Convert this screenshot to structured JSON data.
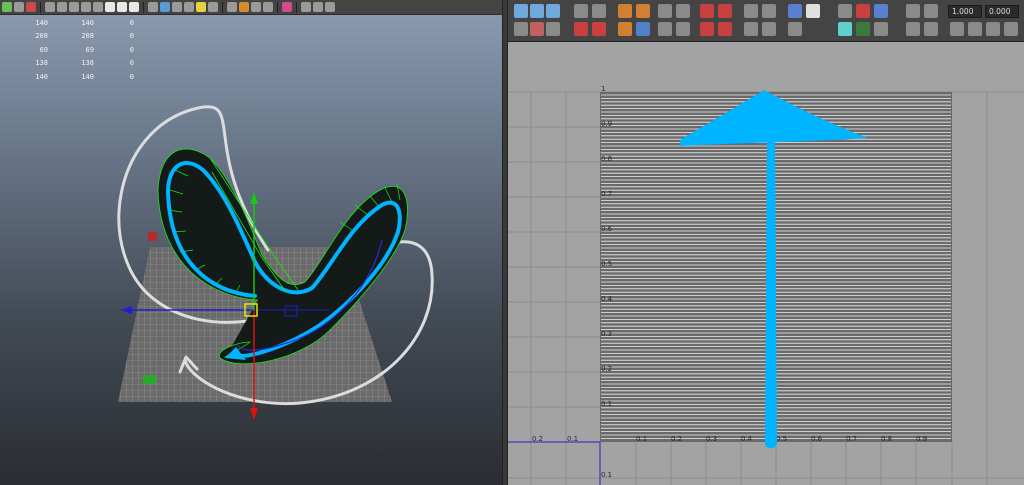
{
  "viewport": {
    "heads_up_display": {
      "rows": [
        [
          "140",
          "140",
          "0"
        ],
        [
          "208",
          "208",
          "0"
        ],
        [
          "69",
          "69",
          "0"
        ],
        [
          "138",
          "138",
          "0"
        ],
        [
          "140",
          "140",
          "0"
        ]
      ]
    }
  },
  "uv_editor": {
    "fields": {
      "value_a": "1.000",
      "value_b": "0.000"
    },
    "tick_labels": {
      "top_left_corner": "1",
      "left_axis": [
        "0.9",
        "0.8",
        "0.7",
        "0.6",
        "0.5",
        "0.4",
        "0.3",
        "0.2",
        "0.1"
      ],
      "bottom_axis": [
        "0.1",
        "0.2",
        "0.3",
        "0.4",
        "0.5",
        "0.6",
        "0.7",
        "0.8",
        "0.9"
      ],
      "outside_left": [
        "0.2",
        "0.1"
      ],
      "below_origin": "0.1"
    }
  },
  "colors": {
    "highlight_blue": "#00b4ff",
    "wire_green": "#19e619",
    "manip_green": "#18c818",
    "manip_red": "#e01010",
    "manip_blue": "#2020d0",
    "manip_yellow": "#e6e600",
    "sketch_white": "#dcdcdc",
    "uv_bg": "#a3a3a3",
    "uv_tile": "#6a6a6a"
  }
}
